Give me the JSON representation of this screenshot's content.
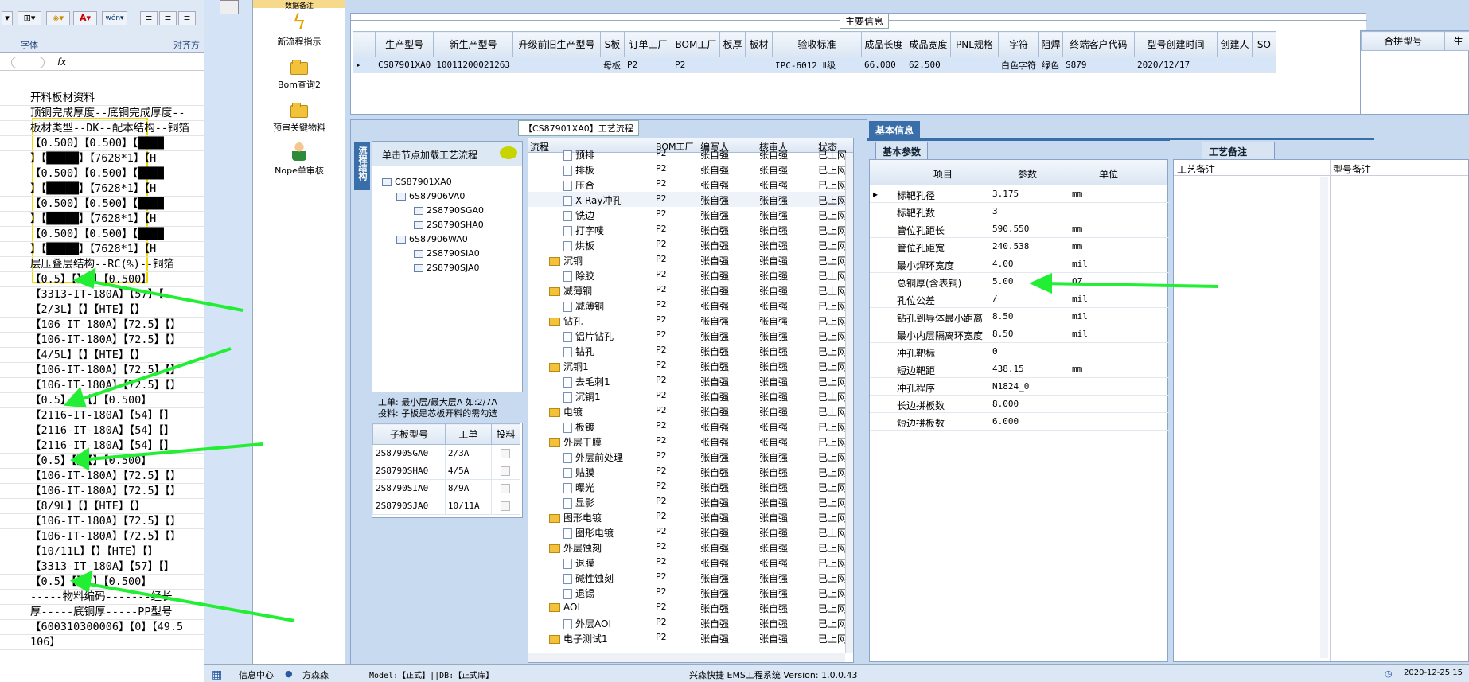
{
  "excel": {
    "ribbon": {
      "font_group": "字体",
      "align_group": "对齐方",
      "fx": "fx"
    },
    "rows": [
      "开料板材资料",
      "顶铜完成厚度--底铜完成厚度--",
      "板材类型--DK--配本结构--铜箔",
      "【0.500】【0.500】【████",
      "】【█████】【7628*1】【H",
      "【0.500】【0.500】【████",
      "】【█████】【7628*1】【H",
      "【0.500】【0.500】【████",
      "】【█████】【7628*1】【H",
      "【0.500】【0.500】【████",
      "】【█████】【7628*1】【H",
      "层压叠层结构--RC(%)--铜箔",
      "【0.5】【】【】【0.500】",
      "【3313-IT-180A】【57】【",
      "【2/3L】【】【HTE】【】",
      "【106-IT-180A】【72.5】【】",
      "【106-IT-180A】【72.5】【】",
      "【4/5L】【】【HTE】【】",
      "【106-IT-180A】【72.5】【】",
      "【106-IT-180A】【72.5】【】",
      "【0.5】【】【】【0.500】",
      "【2116-IT-180A】【54】【】",
      "【2116-IT-180A】【54】【】",
      "【2116-IT-180A】【54】【】",
      "【0.5】【】【】【0.500】",
      "【106-IT-180A】【72.5】【】",
      "【106-IT-180A】【72.5】【】",
      "【8/9L】【】【HTE】【】",
      "【106-IT-180A】【72.5】【】",
      "【106-IT-180A】【72.5】【】",
      "【10/11L】【】【HTE】【】",
      "【3313-IT-180A】【57】【】",
      "【0.5】【】【】【0.500】",
      "-----物料编码-------经长",
      "厚-----底铜厚-----PP型号",
      "【600310300006】【0】【49.5",
      "106】"
    ]
  },
  "tools": [
    {
      "label": "数据备注",
      "icon": "data-icon"
    },
    {
      "label": "新流程指示",
      "icon": "lightning-icon"
    },
    {
      "label": "Bom查询2",
      "icon": "folder-icon"
    },
    {
      "label": "预审关键物料",
      "icon": "folder-icon"
    },
    {
      "label": "Nope单审核",
      "icon": "user-icon"
    }
  ],
  "main_info": {
    "title": "主要信息",
    "headers": [
      "生产型号",
      "新生产型号",
      "升级前旧生产型号",
      "S板",
      "订单工厂",
      "BOM工厂",
      "板厚",
      "板材",
      "验收标准",
      "成品长度",
      "成品宽度",
      "PNL规格",
      "字符",
      "阻焊",
      "终端客户代码",
      "型号创建时间",
      "创建人",
      "SO"
    ],
    "row": [
      "CS87901XA0",
      "10011200021263",
      "",
      "母板",
      "P2",
      "P2",
      "",
      "",
      "IPC-6012 Ⅱ级",
      "66.000",
      "62.500",
      "",
      "白色字符",
      "绿色",
      "S879",
      "2020/12/17",
      "",
      ""
    ],
    "side_headers": [
      "合拼型号",
      "生"
    ]
  },
  "process": {
    "title": "【CS87901XA0】工艺流程",
    "vtab": "流程结构",
    "hint": "单击节点加载工艺流程",
    "tree": [
      "CS87901XA0",
      "6S87906VA0",
      "2S8790SGA0",
      "2S8790SHA0",
      "6S87906WA0",
      "2S8790SIA0",
      "2S8790SJA0"
    ],
    "note1": "工单: 最小层/最大层A 如:2/7A",
    "note2": "投料: 子板是芯板开料的需勾选",
    "sub_headers": [
      "子板型号",
      "工单",
      "投料"
    ],
    "sub_rows": [
      [
        "2S8790SGA0",
        "2/3A"
      ],
      [
        "2S8790SHA0",
        "4/5A"
      ],
      [
        "2S8790SIA0",
        "8/9A"
      ],
      [
        "2S8790SJA0",
        "10/11A"
      ]
    ],
    "flow_headers": [
      "流程",
      "BOM工厂",
      "编写人",
      "核审人",
      "状态"
    ],
    "flow": [
      {
        "n": "预排",
        "t": "p",
        "f": "P2",
        "w": "张自强",
        "r": "张自强",
        "s": "已上网"
      },
      {
        "n": "排板",
        "t": "p",
        "f": "P2",
        "w": "张自强",
        "r": "张自强",
        "s": "已上网"
      },
      {
        "n": "压合",
        "t": "p",
        "f": "P2",
        "w": "张自强",
        "r": "张自强",
        "s": "已上网"
      },
      {
        "n": "X-Ray冲孔",
        "t": "p",
        "f": "P2",
        "w": "张自强",
        "r": "张自强",
        "s": "已上网"
      },
      {
        "n": "铣边",
        "t": "p",
        "f": "P2",
        "w": "张自强",
        "r": "张自强",
        "s": "已上网"
      },
      {
        "n": "打字唛",
        "t": "p",
        "f": "P2",
        "w": "张自强",
        "r": "张自强",
        "s": "已上网"
      },
      {
        "n": "烘板",
        "t": "p",
        "f": "P2",
        "w": "张自强",
        "r": "张自强",
        "s": "已上网"
      },
      {
        "n": "沉铜",
        "t": "f",
        "f": "P2",
        "w": "张自强",
        "r": "张自强",
        "s": "已上网"
      },
      {
        "n": "除胶",
        "t": "p",
        "f": "P2",
        "w": "张自强",
        "r": "张自强",
        "s": "已上网"
      },
      {
        "n": "减薄铜",
        "t": "f",
        "f": "P2",
        "w": "张自强",
        "r": "张自强",
        "s": "已上网"
      },
      {
        "n": "减薄铜",
        "t": "p",
        "f": "P2",
        "w": "张自强",
        "r": "张自强",
        "s": "已上网"
      },
      {
        "n": "钻孔",
        "t": "f",
        "f": "P2",
        "w": "张自强",
        "r": "张自强",
        "s": "已上网"
      },
      {
        "n": "铝片钻孔",
        "t": "p",
        "f": "P2",
        "w": "张自强",
        "r": "张自强",
        "s": "已上网"
      },
      {
        "n": "钻孔",
        "t": "p",
        "f": "P2",
        "w": "张自强",
        "r": "张自强",
        "s": "已上网"
      },
      {
        "n": "沉铜1",
        "t": "f",
        "f": "P2",
        "w": "张自强",
        "r": "张自强",
        "s": "已上网"
      },
      {
        "n": "去毛刺1",
        "t": "p",
        "f": "P2",
        "w": "张自强",
        "r": "张自强",
        "s": "已上网"
      },
      {
        "n": "沉铜1",
        "t": "p",
        "f": "P2",
        "w": "张自强",
        "r": "张自强",
        "s": "已上网"
      },
      {
        "n": "电镀",
        "t": "f",
        "f": "P2",
        "w": "张自强",
        "r": "张自强",
        "s": "已上网"
      },
      {
        "n": "板镀",
        "t": "p",
        "f": "P2",
        "w": "张自强",
        "r": "张自强",
        "s": "已上网"
      },
      {
        "n": "外层干膜",
        "t": "f",
        "f": "P2",
        "w": "张自强",
        "r": "张自强",
        "s": "已上网"
      },
      {
        "n": "外层前处理",
        "t": "p",
        "f": "P2",
        "w": "张自强",
        "r": "张自强",
        "s": "已上网"
      },
      {
        "n": "贴膜",
        "t": "p",
        "f": "P2",
        "w": "张自强",
        "r": "张自强",
        "s": "已上网"
      },
      {
        "n": "曝光",
        "t": "p",
        "f": "P2",
        "w": "张自强",
        "r": "张自强",
        "s": "已上网"
      },
      {
        "n": "显影",
        "t": "p",
        "f": "P2",
        "w": "张自强",
        "r": "张自强",
        "s": "已上网"
      },
      {
        "n": "图形电镀",
        "t": "f",
        "f": "P2",
        "w": "张自强",
        "r": "张自强",
        "s": "已上网"
      },
      {
        "n": "图形电镀",
        "t": "p",
        "f": "P2",
        "w": "张自强",
        "r": "张自强",
        "s": "已上网"
      },
      {
        "n": "外层蚀刻",
        "t": "f",
        "f": "P2",
        "w": "张自强",
        "r": "张自强",
        "s": "已上网"
      },
      {
        "n": "退膜",
        "t": "p",
        "f": "P2",
        "w": "张自强",
        "r": "张自强",
        "s": "已上网"
      },
      {
        "n": "碱性蚀刻",
        "t": "p",
        "f": "P2",
        "w": "张自强",
        "r": "张自强",
        "s": "已上网"
      },
      {
        "n": "退锡",
        "t": "p",
        "f": "P2",
        "w": "张自强",
        "r": "张自强",
        "s": "已上网"
      },
      {
        "n": "AOI",
        "t": "f",
        "f": "P2",
        "w": "张自强",
        "r": "张自强",
        "s": "已上网"
      },
      {
        "n": "外层AOI",
        "t": "p",
        "f": "P2",
        "w": "张自强",
        "r": "张自强",
        "s": "已上网"
      },
      {
        "n": "电子测试1",
        "t": "f",
        "f": "P2",
        "w": "张自强",
        "r": "张自强",
        "s": "已上网"
      }
    ]
  },
  "basic": {
    "tab": "基本信息",
    "subtab": "基本参数",
    "headers": [
      "项目",
      "参数",
      "单位"
    ],
    "rows": [
      [
        "标靶孔径",
        "3.175",
        "mm"
      ],
      [
        "标靶孔数",
        "3",
        ""
      ],
      [
        "管位孔距长",
        "590.550",
        "mm"
      ],
      [
        "管位孔距宽",
        "240.538",
        "mm"
      ],
      [
        "最小焊环宽度",
        "4.00",
        "mil"
      ],
      [
        "总铜厚(含表铜)",
        "5.00",
        "OZ"
      ],
      [
        "孔位公差",
        "/",
        "mil"
      ],
      [
        "钻孔到导体最小距离",
        "8.50",
        "mil"
      ],
      [
        "最小内层隔离环宽度",
        "8.50",
        "mil"
      ],
      [
        "冲孔靶标",
        "0",
        ""
      ],
      [
        "短边靶距",
        "438.15",
        "mm"
      ],
      [
        "冲孔程序",
        "N1824_0",
        ""
      ],
      [
        "长边拼板数",
        "8.000",
        ""
      ],
      [
        "短边拼板数",
        "6.000",
        ""
      ]
    ]
  },
  "remark": {
    "tab": "工艺备注",
    "headers": [
      "工艺备注",
      "型号备注"
    ]
  },
  "status": {
    "info": "信息中心",
    "user": "方森森",
    "model": "Model:【正式】||DB:【正式库】",
    "system": "兴森快捷 EMS工程系统 Version: 1.0.0.43",
    "time": "2020-12-25 15"
  }
}
